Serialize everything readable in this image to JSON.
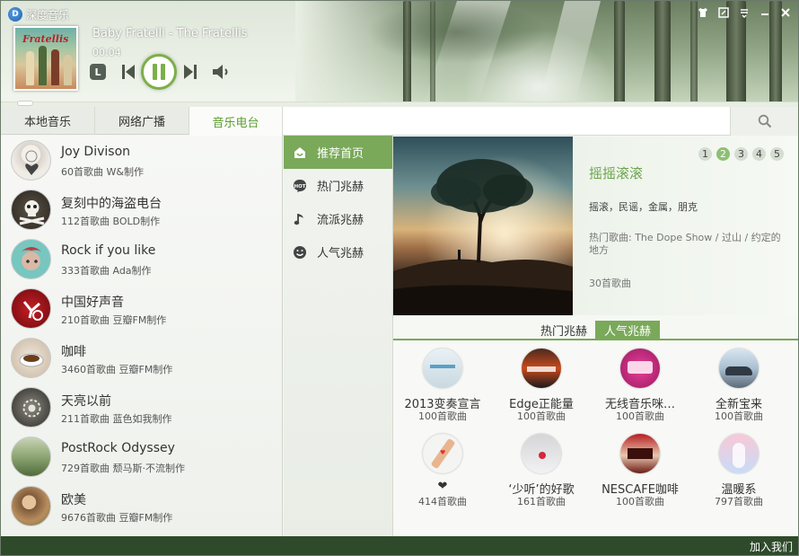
{
  "app": {
    "title": "深度音乐"
  },
  "player": {
    "track_title": "Baby Fratelli - The Fratellis",
    "elapsed": "00:04",
    "album_band": "Fratellis",
    "loop_label": "L",
    "accent": "#7bb047"
  },
  "tabs": [
    {
      "label": "本地音乐"
    },
    {
      "label": "网络广播"
    },
    {
      "label": "音乐电台"
    }
  ],
  "stations": [
    {
      "name": "Joy Divison",
      "meta": "60首歌曲 W&制作"
    },
    {
      "name": "复刻中的海盗电台",
      "meta": "112首歌曲 BOLD制作"
    },
    {
      "name": "Rock if you like",
      "meta": "333首歌曲 Ada制作"
    },
    {
      "name": "中国好声音",
      "meta": "210首歌曲 豆瓣FM制作"
    },
    {
      "name": "咖啡",
      "meta": "3460首歌曲 豆瓣FM制作"
    },
    {
      "name": "天亮以前",
      "meta": "211首歌曲 蓝色如我制作"
    },
    {
      "name": "PostRock Odyssey",
      "meta": "729首歌曲 颓马斯·不流制作"
    },
    {
      "name": "欧美",
      "meta": "9676首歌曲 豆瓣FM制作"
    }
  ],
  "categories": [
    {
      "label": "推荐首页",
      "icon": "home-icon"
    },
    {
      "label": "热门兆赫",
      "icon": "hot-icon"
    },
    {
      "label": "流派兆赫",
      "icon": "music-note-icon"
    },
    {
      "label": "人气兆赫",
      "icon": "smile-icon"
    }
  ],
  "featured": {
    "title": "摇摇滚滚",
    "tags": "摇滚，民谣，金属，朋克",
    "hot_songs": "热门歌曲: The Dope Show / 过山 / 约定的地方",
    "count": "30首歌曲",
    "pages": [
      "1",
      "2",
      "3",
      "4",
      "5"
    ],
    "active_page": "2"
  },
  "subtabs": [
    {
      "label": "热门兆赫"
    },
    {
      "label": "人气兆赫"
    }
  ],
  "grid": [
    {
      "name": "2013变奏宣言",
      "count": "100首歌曲"
    },
    {
      "name": "Edge正能量",
      "count": "100首歌曲"
    },
    {
      "name": "无线音乐咪…",
      "count": "100首歌曲"
    },
    {
      "name": "全新宝来",
      "count": "100首歌曲"
    },
    {
      "name": "❤",
      "count": "414首歌曲"
    },
    {
      "name": "‘少听’的好歌",
      "count": "161首歌曲"
    },
    {
      "name": "NESCAFE咖啡",
      "count": "100首歌曲"
    },
    {
      "name": "温暖系",
      "count": "797首歌曲"
    }
  ],
  "footer": {
    "join_label": "加入我们"
  }
}
